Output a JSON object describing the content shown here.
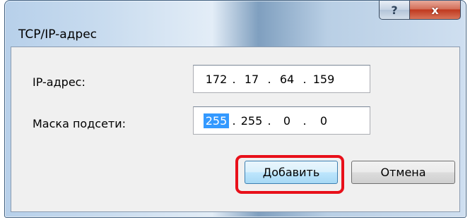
{
  "window": {
    "title": "TCP/IP-адрес",
    "help_glyph": "?",
    "close_glyph": "x"
  },
  "form": {
    "ip_label": "IP-адрес:",
    "ip_octets": [
      "172",
      "17",
      "64",
      "159"
    ],
    "mask_label": "Маска подсети:",
    "mask_octets": [
      "255",
      "255",
      "0",
      "0"
    ],
    "separator": "."
  },
  "buttons": {
    "add_label": "Добавить",
    "cancel_label": "Отмена"
  },
  "colors": {
    "highlight": "#e8101a",
    "selection": "#3399ff"
  },
  "icons": {
    "help": "help-question-icon",
    "close": "close-x-icon"
  }
}
